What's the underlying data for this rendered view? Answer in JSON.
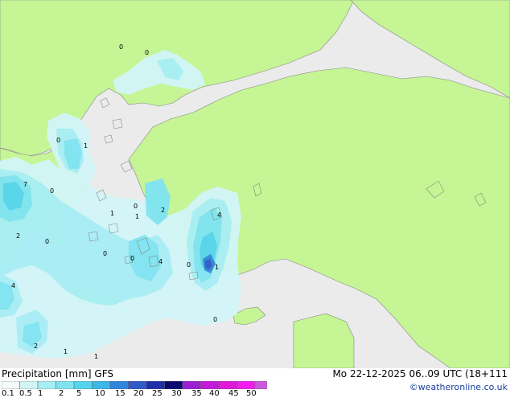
{
  "header": {
    "title": "Precipitation [mm]",
    "model": "GFS",
    "datetime": "Mo 22-12-2025 06..09 UTC (18+111",
    "credit": "©weatheronline.co.uk"
  },
  "legend": {
    "ticks": [
      "0.1",
      "0.5",
      "1",
      "2",
      "5",
      "10",
      "15",
      "20",
      "25",
      "30",
      "35",
      "40",
      "45",
      "50"
    ],
    "colors": [
      "#f5fdfd",
      "#d2f6f8",
      "#a8eef5",
      "#7fe4f2",
      "#55d4ee",
      "#3cb7e8",
      "#2f86dc",
      "#2f5ac7",
      "#1f2fa8",
      "#0a0a6e",
      "#9b1fd3",
      "#c21ad8",
      "#e018d8",
      "#f21cf0",
      "#c85ad8"
    ]
  },
  "colors": {
    "land": "#c5f595",
    "sea": "#ebebeb",
    "border": "#888888"
  },
  "values": [
    {
      "text": "0"
    },
    {
      "text": "0"
    },
    {
      "text": "0"
    },
    {
      "text": "1"
    },
    {
      "text": "7"
    },
    {
      "text": "0"
    },
    {
      "text": "2"
    },
    {
      "text": "0"
    },
    {
      "text": "1"
    },
    {
      "text": "1"
    },
    {
      "text": "0"
    },
    {
      "text": "4"
    },
    {
      "text": "2"
    },
    {
      "text": "0"
    },
    {
      "text": "4"
    },
    {
      "text": "4"
    },
    {
      "text": "0"
    },
    {
      "text": "1"
    },
    {
      "text": "0"
    },
    {
      "text": "2"
    },
    {
      "text": "1"
    },
    {
      "text": "1"
    },
    {
      "text": "0"
    }
  ]
}
